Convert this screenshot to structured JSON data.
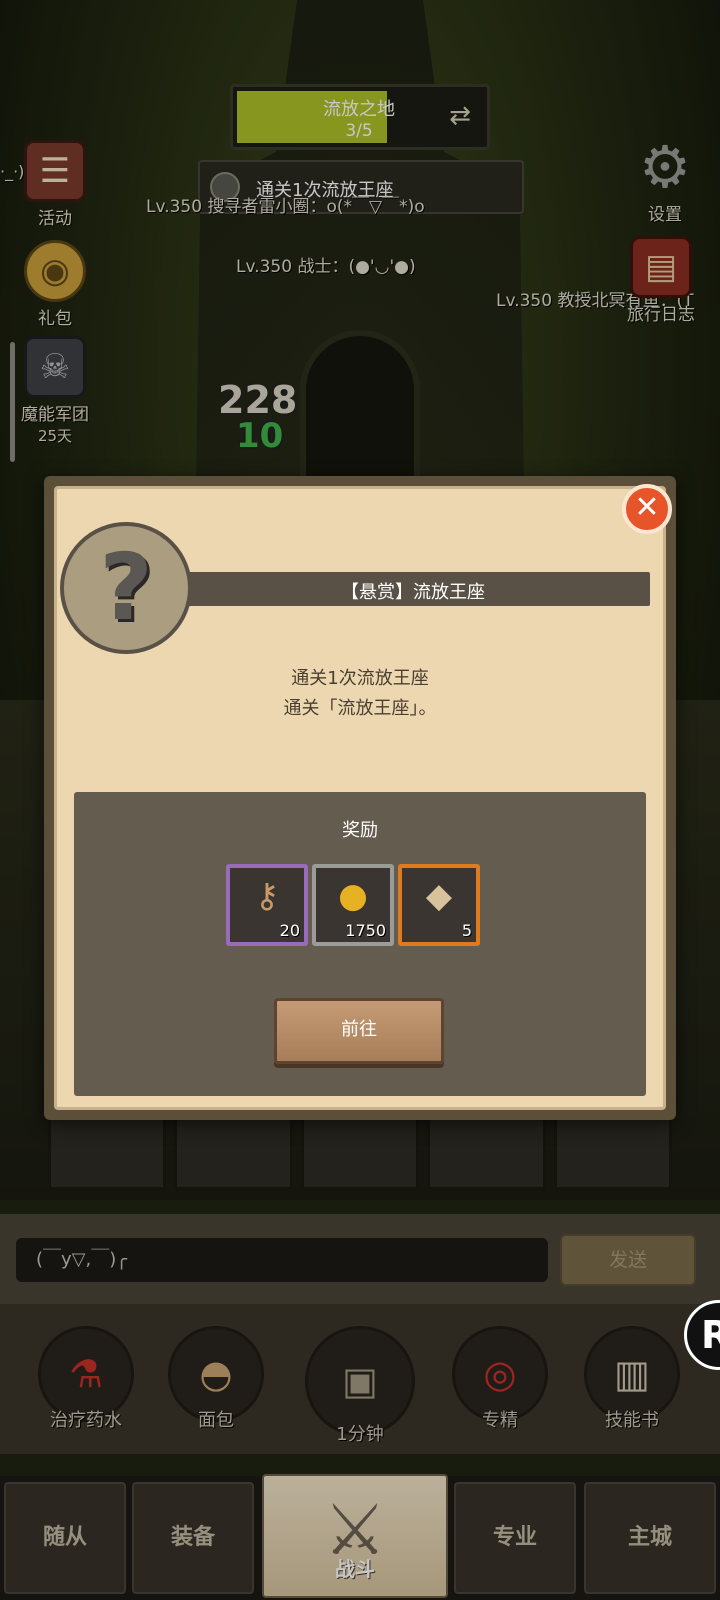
{
  "zone": {
    "name": "流放之地",
    "progress": "3/5"
  },
  "quest_bar": {
    "text": "通关1次流放王座"
  },
  "players": [
    {
      "label": "Lv.350 搜寻者雷小圈：o(*￣▽￣*)o"
    },
    {
      "label": "Lv.350 战士：(●'◡'●)"
    },
    {
      "label": "Lv.350 教授北冥有鱼：(T"
    }
  ],
  "combat_numbers": [
    "228",
    "10"
  ],
  "left_menu": {
    "activity": "活动",
    "gift": "礼包",
    "legion": "魔能军团",
    "legion_days": "25天",
    "partial_emote": "·_·)"
  },
  "right_menu": {
    "settings": "设置",
    "journal": "旅行日志"
  },
  "dialog": {
    "title": "【悬赏】流放王座",
    "desc_line1": "通关1次流放王座",
    "desc_line2": "通关「流放王座」。",
    "reward_title": "奖励",
    "rewards": [
      {
        "icon": "key-icon",
        "count": "20",
        "border": "#9a6bbb"
      },
      {
        "icon": "gold-coin-icon",
        "count": "1750",
        "border": "#9b9b98"
      },
      {
        "icon": "stone-block-icon",
        "count": "5",
        "border": "#e07a1e"
      }
    ],
    "go_button": "前往"
  },
  "chat": {
    "input_text": "(￣y▽,￣)╭",
    "send": "发送"
  },
  "consumables": [
    {
      "label": "治疗药水",
      "icon": "potion-icon"
    },
    {
      "label": "面包",
      "icon": "bread-icon"
    },
    {
      "label": "1分钟",
      "icon": "treasure-chest-icon"
    },
    {
      "label": "专精",
      "icon": "mastery-icon"
    },
    {
      "label": "技能书",
      "icon": "skill-book-icon"
    }
  ],
  "nav": {
    "follower": "随从",
    "equipment": "装备",
    "battle": "战斗",
    "profession": "专业",
    "main_city": "主城"
  },
  "colors": {
    "accent_green": "#adc027",
    "close_red": "#e8542a",
    "parchment": "#ecd7b0"
  }
}
